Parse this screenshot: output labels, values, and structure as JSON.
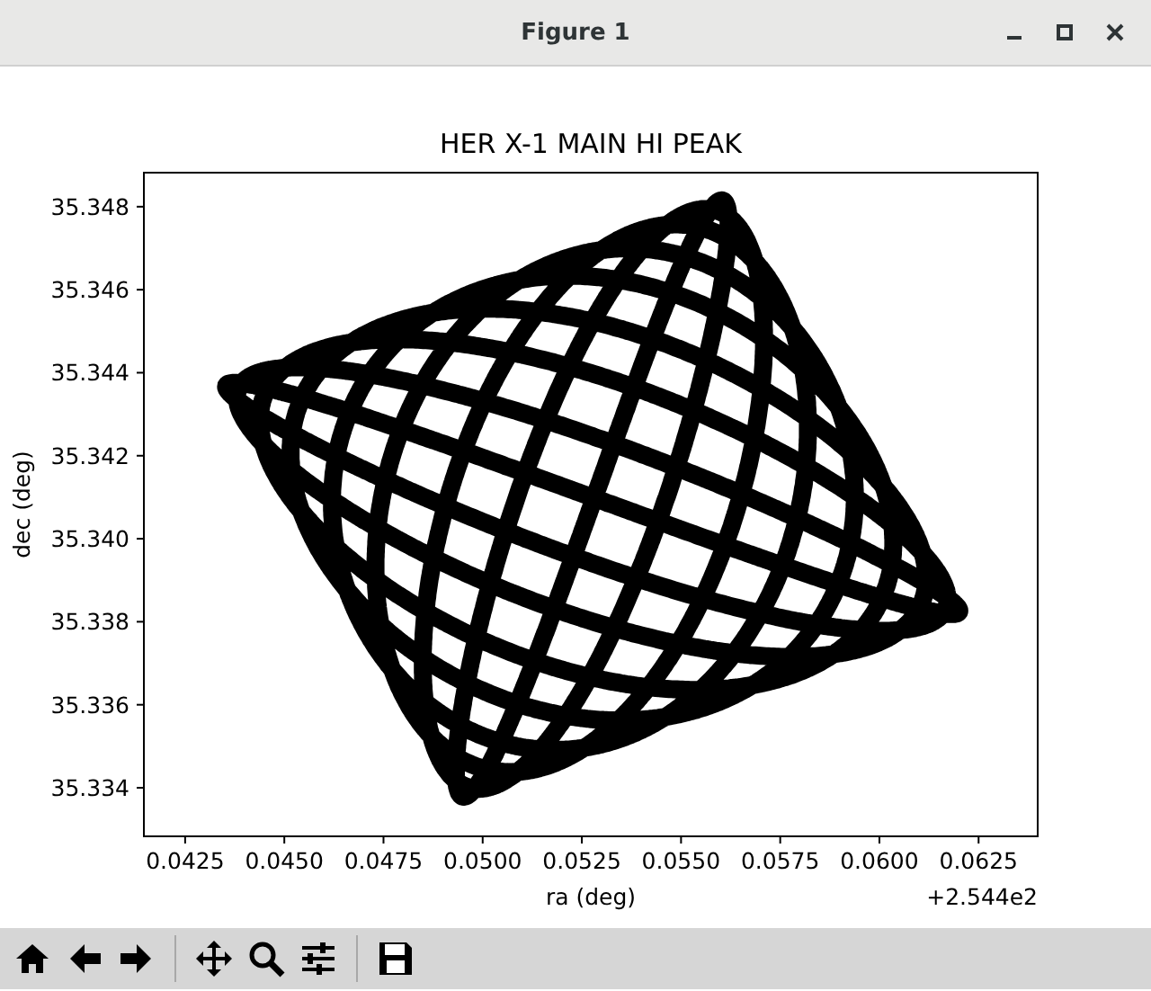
{
  "window": {
    "title": "Figure 1"
  },
  "plot": {
    "chart_data": {
      "type": "scatter",
      "title": "HER X-1 MAIN HI PEAK",
      "xlabel": "ra (deg)",
      "ylabel": "dec (deg)",
      "xlim": [
        0.04146,
        0.06399
      ],
      "ylim": [
        35.33283,
        35.34882
      ],
      "xticks": [
        {
          "value": 0.0425,
          "label": "0.0425"
        },
        {
          "value": 0.045,
          "label": "0.0450"
        },
        {
          "value": 0.0475,
          "label": "0.0475"
        },
        {
          "value": 0.05,
          "label": "0.0500"
        },
        {
          "value": 0.0525,
          "label": "0.0525"
        },
        {
          "value": 0.055,
          "label": "0.0550"
        },
        {
          "value": 0.0575,
          "label": "0.0575"
        },
        {
          "value": 0.06,
          "label": "0.0600"
        },
        {
          "value": 0.0625,
          "label": "0.0625"
        }
      ],
      "yticks": [
        {
          "value": 35.334,
          "label": "35.334"
        },
        {
          "value": 35.336,
          "label": "35.336"
        },
        {
          "value": 35.338,
          "label": "35.338"
        },
        {
          "value": 35.34,
          "label": "35.340"
        },
        {
          "value": 35.342,
          "label": "35.342"
        },
        {
          "value": 35.344,
          "label": "35.344"
        },
        {
          "value": 35.346,
          "label": "35.346"
        },
        {
          "value": 35.348,
          "label": "35.348"
        }
      ],
      "annotations": [
        "+2.544e2"
      ]
    }
  },
  "toolbar": {
    "groups": [
      [
        {
          "kind": "home"
        },
        {
          "kind": "back"
        },
        {
          "kind": "forward"
        }
      ],
      [
        {
          "kind": "pan"
        },
        {
          "kind": "zoom"
        },
        {
          "kind": "subplots"
        }
      ],
      [
        {
          "kind": "save"
        }
      ]
    ]
  }
}
